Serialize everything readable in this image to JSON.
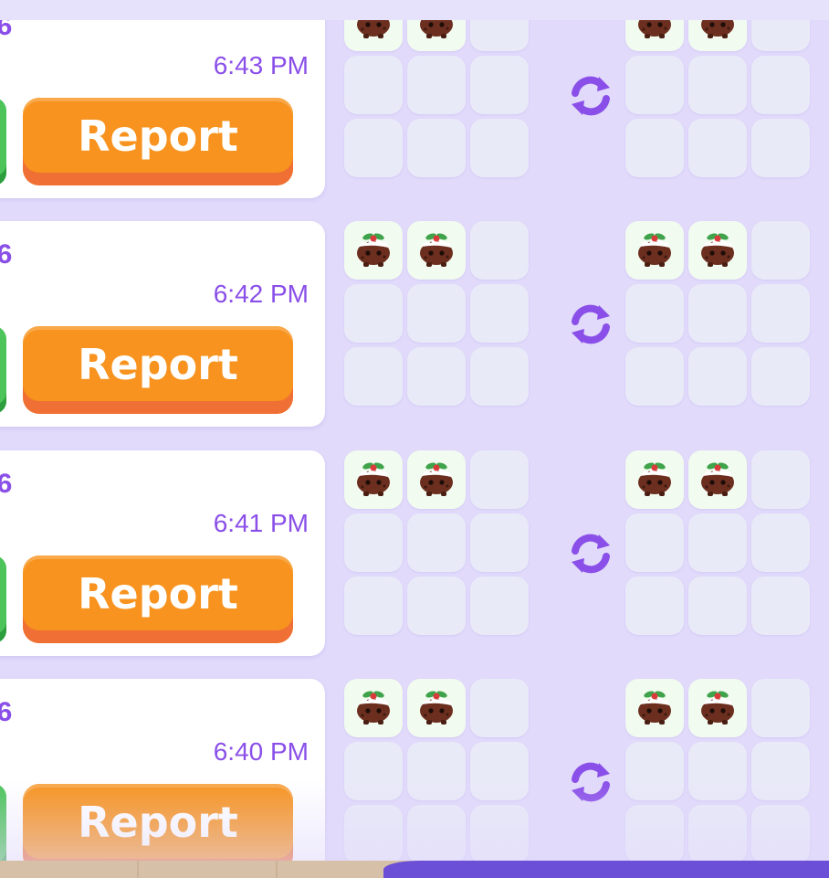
{
  "colors": {
    "accent": "#8a4fe8",
    "report_button": "#f7931e",
    "accept_button": "#4cc45a",
    "panel_background": "#e1dafb",
    "empty_slot": "#e9eaf8",
    "filled_slot": "#f2fbef"
  },
  "trades": [
    {
      "id": "06",
      "time": "6:43 PM",
      "report_label": "Report",
      "left_items": [
        "pudding-pet",
        "pudding-pet"
      ],
      "right_items": [
        "pudding-pet",
        "pudding-pet"
      ]
    },
    {
      "id": "06",
      "time": "6:42 PM",
      "report_label": "Report",
      "left_items": [
        "pudding-pet",
        "pudding-pet"
      ],
      "right_items": [
        "pudding-pet",
        "pudding-pet"
      ]
    },
    {
      "id": "06",
      "time": "6:41 PM",
      "report_label": "Report",
      "left_items": [
        "pudding-pet",
        "pudding-pet"
      ],
      "right_items": [
        "pudding-pet",
        "pudding-pet"
      ]
    },
    {
      "id": "06",
      "time": "6:40 PM",
      "report_label": "Report",
      "left_items": [
        "pudding-pet",
        "pudding-pet"
      ],
      "right_items": [
        "pudding-pet",
        "pudding-pet"
      ]
    }
  ],
  "icons": {
    "swap": "swap-arrows-icon",
    "pet": "christmas-pudding-pet-icon"
  }
}
